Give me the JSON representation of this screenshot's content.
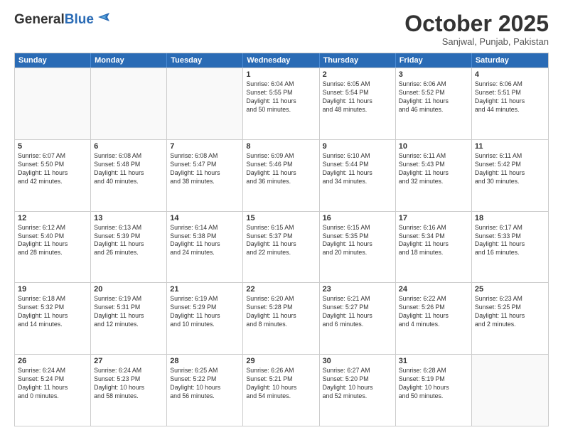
{
  "header": {
    "logo_line1": "General",
    "logo_line2": "Blue",
    "month": "October 2025",
    "location": "Sanjwal, Punjab, Pakistan"
  },
  "weekdays": [
    "Sunday",
    "Monday",
    "Tuesday",
    "Wednesday",
    "Thursday",
    "Friday",
    "Saturday"
  ],
  "rows": [
    [
      {
        "day": "",
        "info": ""
      },
      {
        "day": "",
        "info": ""
      },
      {
        "day": "",
        "info": ""
      },
      {
        "day": "1",
        "info": "Sunrise: 6:04 AM\nSunset: 5:55 PM\nDaylight: 11 hours\nand 50 minutes."
      },
      {
        "day": "2",
        "info": "Sunrise: 6:05 AM\nSunset: 5:54 PM\nDaylight: 11 hours\nand 48 minutes."
      },
      {
        "day": "3",
        "info": "Sunrise: 6:06 AM\nSunset: 5:52 PM\nDaylight: 11 hours\nand 46 minutes."
      },
      {
        "day": "4",
        "info": "Sunrise: 6:06 AM\nSunset: 5:51 PM\nDaylight: 11 hours\nand 44 minutes."
      }
    ],
    [
      {
        "day": "5",
        "info": "Sunrise: 6:07 AM\nSunset: 5:50 PM\nDaylight: 11 hours\nand 42 minutes."
      },
      {
        "day": "6",
        "info": "Sunrise: 6:08 AM\nSunset: 5:48 PM\nDaylight: 11 hours\nand 40 minutes."
      },
      {
        "day": "7",
        "info": "Sunrise: 6:08 AM\nSunset: 5:47 PM\nDaylight: 11 hours\nand 38 minutes."
      },
      {
        "day": "8",
        "info": "Sunrise: 6:09 AM\nSunset: 5:46 PM\nDaylight: 11 hours\nand 36 minutes."
      },
      {
        "day": "9",
        "info": "Sunrise: 6:10 AM\nSunset: 5:44 PM\nDaylight: 11 hours\nand 34 minutes."
      },
      {
        "day": "10",
        "info": "Sunrise: 6:11 AM\nSunset: 5:43 PM\nDaylight: 11 hours\nand 32 minutes."
      },
      {
        "day": "11",
        "info": "Sunrise: 6:11 AM\nSunset: 5:42 PM\nDaylight: 11 hours\nand 30 minutes."
      }
    ],
    [
      {
        "day": "12",
        "info": "Sunrise: 6:12 AM\nSunset: 5:40 PM\nDaylight: 11 hours\nand 28 minutes."
      },
      {
        "day": "13",
        "info": "Sunrise: 6:13 AM\nSunset: 5:39 PM\nDaylight: 11 hours\nand 26 minutes."
      },
      {
        "day": "14",
        "info": "Sunrise: 6:14 AM\nSunset: 5:38 PM\nDaylight: 11 hours\nand 24 minutes."
      },
      {
        "day": "15",
        "info": "Sunrise: 6:15 AM\nSunset: 5:37 PM\nDaylight: 11 hours\nand 22 minutes."
      },
      {
        "day": "16",
        "info": "Sunrise: 6:15 AM\nSunset: 5:35 PM\nDaylight: 11 hours\nand 20 minutes."
      },
      {
        "day": "17",
        "info": "Sunrise: 6:16 AM\nSunset: 5:34 PM\nDaylight: 11 hours\nand 18 minutes."
      },
      {
        "day": "18",
        "info": "Sunrise: 6:17 AM\nSunset: 5:33 PM\nDaylight: 11 hours\nand 16 minutes."
      }
    ],
    [
      {
        "day": "19",
        "info": "Sunrise: 6:18 AM\nSunset: 5:32 PM\nDaylight: 11 hours\nand 14 minutes."
      },
      {
        "day": "20",
        "info": "Sunrise: 6:19 AM\nSunset: 5:31 PM\nDaylight: 11 hours\nand 12 minutes."
      },
      {
        "day": "21",
        "info": "Sunrise: 6:19 AM\nSunset: 5:29 PM\nDaylight: 11 hours\nand 10 minutes."
      },
      {
        "day": "22",
        "info": "Sunrise: 6:20 AM\nSunset: 5:28 PM\nDaylight: 11 hours\nand 8 minutes."
      },
      {
        "day": "23",
        "info": "Sunrise: 6:21 AM\nSunset: 5:27 PM\nDaylight: 11 hours\nand 6 minutes."
      },
      {
        "day": "24",
        "info": "Sunrise: 6:22 AM\nSunset: 5:26 PM\nDaylight: 11 hours\nand 4 minutes."
      },
      {
        "day": "25",
        "info": "Sunrise: 6:23 AM\nSunset: 5:25 PM\nDaylight: 11 hours\nand 2 minutes."
      }
    ],
    [
      {
        "day": "26",
        "info": "Sunrise: 6:24 AM\nSunset: 5:24 PM\nDaylight: 11 hours\nand 0 minutes."
      },
      {
        "day": "27",
        "info": "Sunrise: 6:24 AM\nSunset: 5:23 PM\nDaylight: 10 hours\nand 58 minutes."
      },
      {
        "day": "28",
        "info": "Sunrise: 6:25 AM\nSunset: 5:22 PM\nDaylight: 10 hours\nand 56 minutes."
      },
      {
        "day": "29",
        "info": "Sunrise: 6:26 AM\nSunset: 5:21 PM\nDaylight: 10 hours\nand 54 minutes."
      },
      {
        "day": "30",
        "info": "Sunrise: 6:27 AM\nSunset: 5:20 PM\nDaylight: 10 hours\nand 52 minutes."
      },
      {
        "day": "31",
        "info": "Sunrise: 6:28 AM\nSunset: 5:19 PM\nDaylight: 10 hours\nand 50 minutes."
      },
      {
        "day": "",
        "info": ""
      }
    ]
  ]
}
